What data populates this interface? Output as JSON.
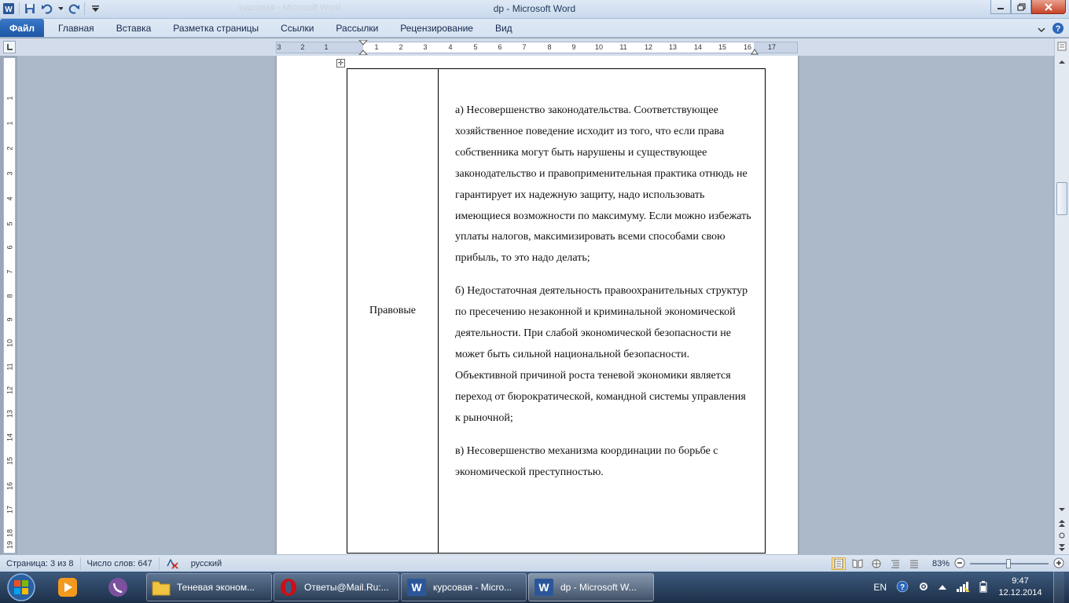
{
  "window": {
    "title": "dp  -  Microsoft Word",
    "ghost_title": "курсовая - Microsoft Word"
  },
  "ribbon": {
    "tabs": [
      {
        "label": "Файл"
      },
      {
        "label": "Главная"
      },
      {
        "label": "Вставка"
      },
      {
        "label": "Разметка страницы"
      },
      {
        "label": "Ссылки"
      },
      {
        "label": "Рассылки"
      },
      {
        "label": "Рецензирование"
      },
      {
        "label": "Вид"
      }
    ]
  },
  "ruler": {
    "h_numbers": [
      "3",
      "2",
      "1",
      "1",
      "2",
      "3",
      "4",
      "5",
      "6",
      "7",
      "8",
      "9",
      "10",
      "11",
      "12",
      "13",
      "14",
      "15",
      "16",
      "17"
    ],
    "v_numbers": [
      "1",
      "1",
      "2",
      "3",
      "4",
      "5",
      "6",
      "7",
      "8",
      "9",
      "10",
      "11",
      "12",
      "13",
      "14",
      "15",
      "16",
      "17",
      "18",
      "19"
    ]
  },
  "document": {
    "table": {
      "left_cell": "Правовые",
      "paragraphs": [
        "а) Несовершенство законодательства. Соответствующее хозяйственное поведение исходит из того, что если права собственника могут быть нарушены и существующее законодательство и правоприменительная практика отнюдь не гарантирует их надежную защиту, надо использовать имеющиеся возможности по максимуму. Если можно избежать уплаты налогов, максимизировать всеми способами свою прибыль, то это надо делать;",
        "б) Недостаточная деятельность правоохранительных структур по пресечению незаконной и криминальной экономической деятельности. При слабой экономической безопасности не может быть сильной национальной безопасности. Объективной причиной роста теневой экономики является переход от бюрократической, командной системы управления к рыночной;",
        "в) Несовершенство механизма координации по борьбе с экономической преступностью."
      ]
    }
  },
  "statusbar": {
    "page": "Страница: 3 из 8",
    "words": "Число слов: 647",
    "language": "русский",
    "zoom": "83%"
  },
  "taskbar": {
    "tasks": [
      {
        "label": "Теневая эконом..."
      },
      {
        "label": "Ответы@Mail.Ru:..."
      },
      {
        "label": "курсовая - Micro..."
      },
      {
        "label": "dp - Microsoft W..."
      }
    ],
    "lang": "EN",
    "time": "9:47",
    "date": "12.12.2014"
  },
  "colors": {
    "file_tab": "#2a67b8",
    "word_blue": "#2b579a",
    "opera_red": "#cc0f16",
    "viber_purple": "#7b519d"
  }
}
